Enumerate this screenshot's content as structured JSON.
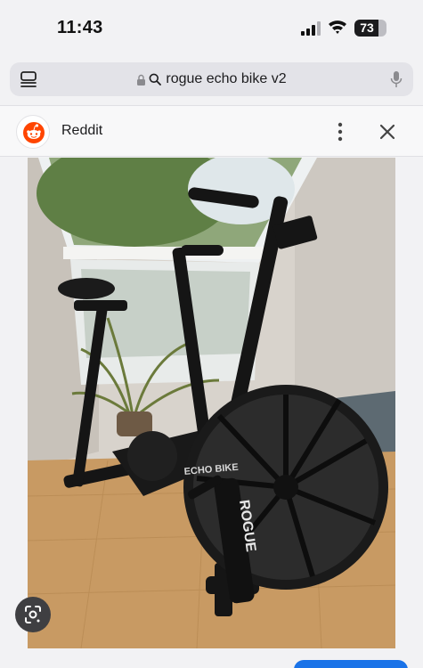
{
  "status_bar": {
    "time": "11:43",
    "battery": "73"
  },
  "search_bar": {
    "query": "rogue echo bike v2"
  },
  "banner": {
    "source": "Reddit"
  },
  "image": {
    "brand_text": "ROGUE",
    "model_text": "ECHO BIKE"
  },
  "colors": {
    "reddit_orange": "#ff4500",
    "accent_blue": "#1a73e8"
  }
}
